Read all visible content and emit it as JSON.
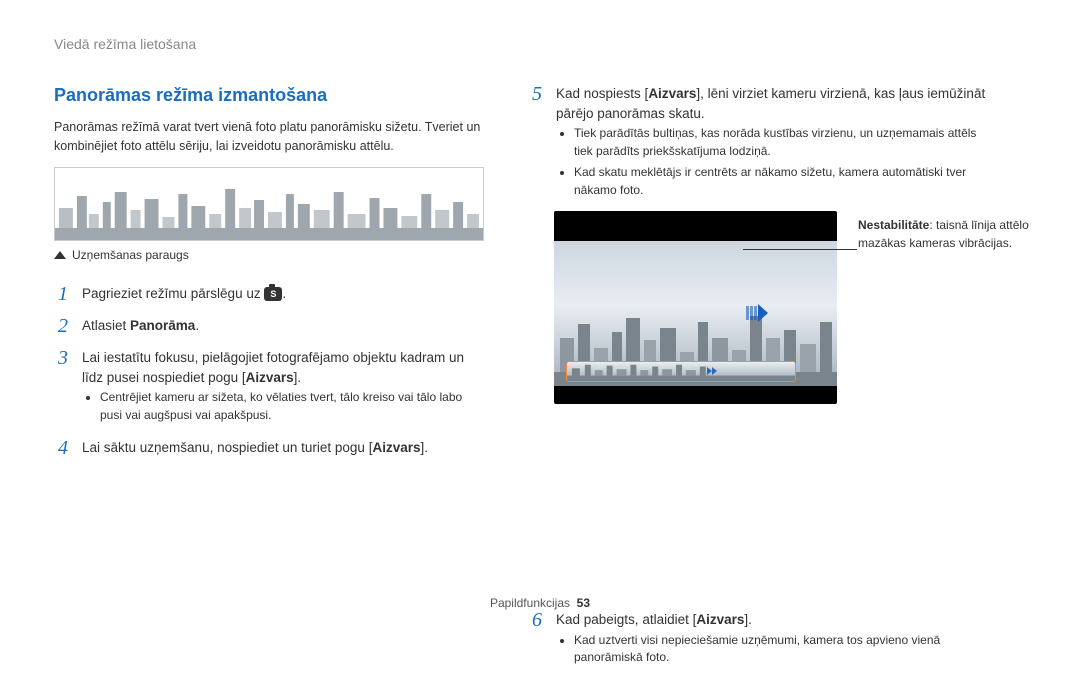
{
  "header": {
    "breadcrumb": "Viedā režīma lietošana"
  },
  "left": {
    "title": "Panorāmas režīma izmantošana",
    "intro": "Panorāmas režīmā varat tvert vienā foto platu panorāmisku sižetu. Tveriet un kombinējiet foto attēlu sēriju, lai izveidotu panorāmisku attēlu.",
    "caption": "Uzņemšanas paraugs",
    "steps": {
      "s1_pre": "Pagrieziet režīmu pārslēgu uz ",
      "s1_post": ".",
      "s2_pre": "Atlasiet ",
      "s2_bold": "Panorāma",
      "s2_post": ".",
      "s3_pre": "Lai iestatītu fokusu, pielāgojiet fotografējamo objektu kadram un līdz pusei nospiediet pogu [",
      "s3_bold": "Aizvars",
      "s3_post": "].",
      "s3_bullet": "Centrējiet kameru ar sižeta, ko vēlaties tvert, tālo kreiso vai tālo labo pusi vai augšpusi vai apakšpusi.",
      "s4_pre": "Lai sāktu uzņemšanu, nospiediet un turiet pogu [",
      "s4_bold": "Aizvars",
      "s4_post": "]."
    }
  },
  "right": {
    "steps": {
      "s5_pre": "Kad nospiests [",
      "s5_bold": "Aizvars",
      "s5_post": "], lēni virziet kameru virzienā, kas ļaus iemūžināt pārējo panorāmas skatu.",
      "s5_bullets": [
        "Tiek parādītās bultiņas, kas norāda kustības virzienu, un uzņemamais attēls tiek parādīts priekšskatījuma lodziņā.",
        "Kad skatu meklētājs ir centrēts ar nākamo sižetu, kamera automātiski tver nākamo foto."
      ],
      "annotation_bold": "Nestabilitāte",
      "annotation_text": ": taisnā līnija attēlo mazākas kameras vibrācijas.",
      "s6_pre": "Kad pabeigts, atlaidiet [",
      "s6_bold": "Aizvars",
      "s6_post": "].",
      "s6_bullet": "Kad uztverti visi nepieciešamie uzņēmumi, kamera tos apvieno vienā panorāmiskā foto."
    }
  },
  "footer": {
    "label": "Papildfunkcijas",
    "page": "53"
  }
}
